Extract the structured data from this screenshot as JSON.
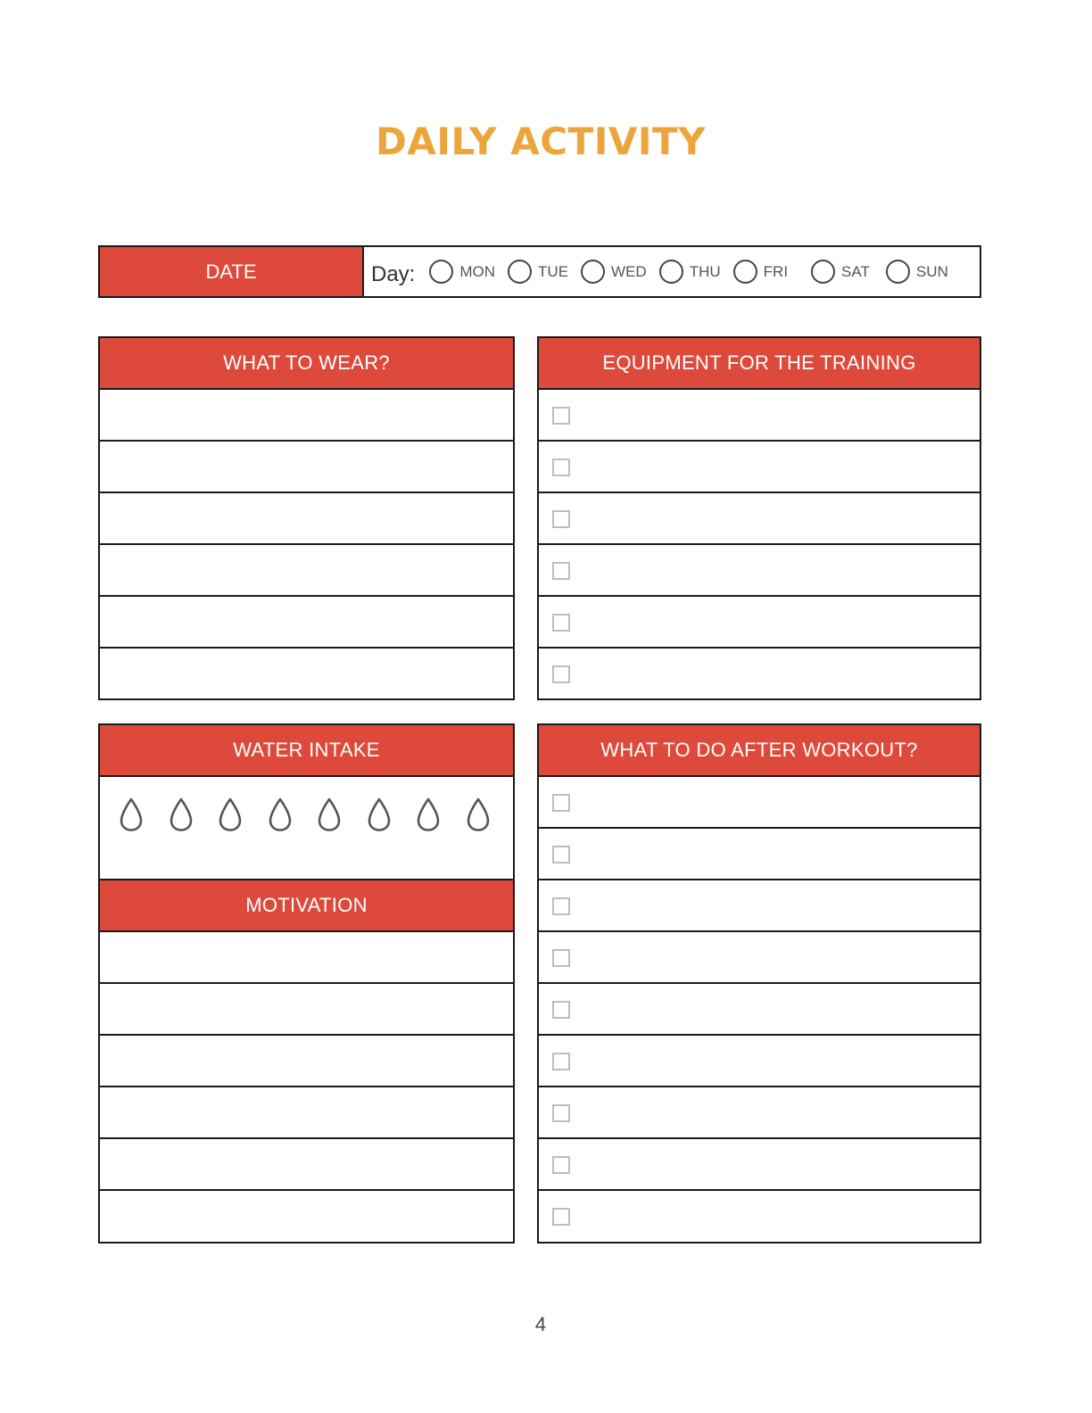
{
  "title": "DAILY ACTIVITY",
  "date_bar": {
    "date_label": "DATE",
    "day_prefix": "Day:",
    "days": [
      "MON",
      "TUE",
      "WED",
      "THU",
      "FRI",
      "SAT",
      "SUN"
    ]
  },
  "panels": {
    "what_to_wear": {
      "title": "WHAT TO WEAR?",
      "rows": 6
    },
    "equipment": {
      "title": "EQUIPMENT FOR THE TRAINING",
      "rows": 6,
      "checkbox_icon": "empty-checkbox"
    },
    "water_intake": {
      "title": "WATER INTAKE",
      "drops": 8,
      "drop_icon": "water-drop-outline"
    },
    "motivation": {
      "title": "MOTIVATION",
      "rows": 6
    },
    "after_workout": {
      "title": "WHAT TO DO AFTER WORKOUT?",
      "rows": 9,
      "checkbox_icon": "empty-checkbox"
    }
  },
  "colors": {
    "title": "#eba53b",
    "header_bg": "#dd4a3b",
    "header_text": "#ffffff",
    "border": "#1a1a1a",
    "checkbox": "#bdbdbd"
  },
  "page_number": "4"
}
